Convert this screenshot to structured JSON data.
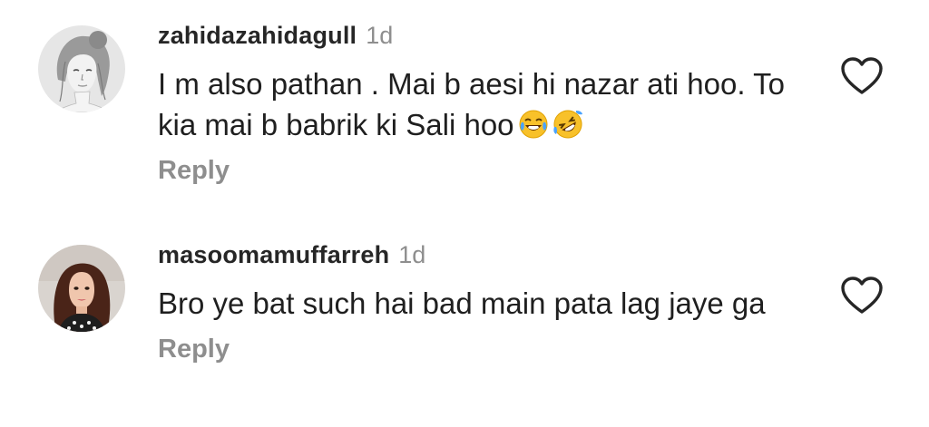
{
  "comments": [
    {
      "username": "zahidazahidagull",
      "time": "1d",
      "text": "I m also pathan . Mai b aesi hi nazar ati hoo. To kia mai b babrik ki Sali hoo",
      "emojis": [
        "face-with-tears-of-joy",
        "rolling-on-the-floor-laughing"
      ],
      "reply_label": "Reply",
      "avatar_icon": "avatar-sketch-girl",
      "like_icon": "heart-outline-icon"
    },
    {
      "username": "masoomamuffarreh",
      "time": "1d",
      "text": "Bro ye bat such hai bad main pata lag jaye ga",
      "reply_label": "Reply",
      "avatar_icon": "avatar-photo-woman",
      "like_icon": "heart-outline-icon"
    }
  ],
  "colors": {
    "username": "#262626",
    "meta": "#8e8e8e",
    "text": "#1f1f1f",
    "background": "#ffffff"
  }
}
